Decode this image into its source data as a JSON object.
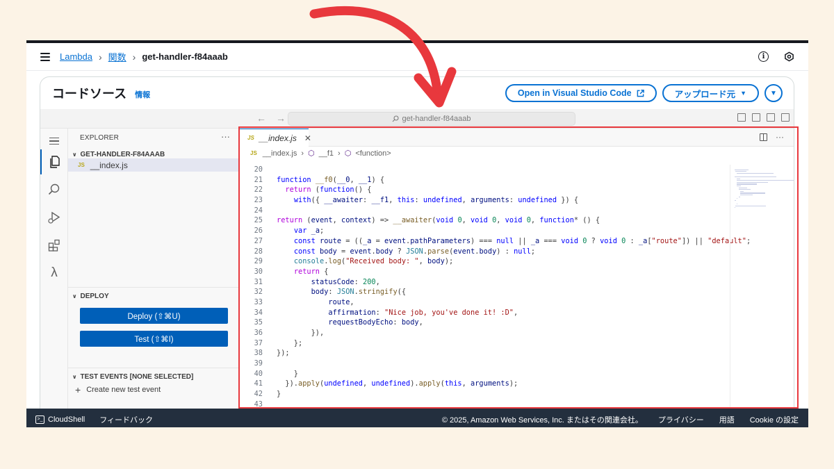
{
  "nav": {
    "breadcrumb": [
      "Lambda",
      "関数",
      "get-handler-f84aaab"
    ]
  },
  "panel": {
    "title": "コードソース",
    "info_link": "情報",
    "open_vscode_label": "Open in Visual Studio Code",
    "upload_label": "アップロード元"
  },
  "ide": {
    "command_center": "get-handler-f84aaab",
    "explorer": {
      "header": "EXPLORER",
      "folder": "GET-HANDLER-F84AAAB",
      "file": "__index.js",
      "file_badge": "JS"
    },
    "deploy": {
      "header": "DEPLOY",
      "deploy_label": "Deploy (⇧⌘U)",
      "test_label": "Test (⇧⌘I)"
    },
    "test_events": {
      "header": "TEST EVENTS [NONE SELECTED]",
      "create_label": "Create new test event"
    },
    "editor": {
      "tab_label": "__index.js",
      "breadcrumb": [
        "__index.js",
        "__f1",
        "<function>"
      ]
    }
  },
  "footer": {
    "cloudshell": "CloudShell",
    "feedback": "フィードバック",
    "copyright": "© 2025, Amazon Web Services, Inc. またはその関連会社。",
    "privacy": "プライバシー",
    "terms": "用語",
    "cookie": "Cookie の設定"
  },
  "code_lines": [
    {
      "n": "20",
      "text": ""
    },
    {
      "n": "21",
      "text": "function __f0(__0, __1) {"
    },
    {
      "n": "22",
      "text": "  return (function() {"
    },
    {
      "n": "23",
      "text": "    with({ __awaiter: __f1, this: undefined, arguments: undefined }) {"
    },
    {
      "n": "24",
      "text": ""
    },
    {
      "n": "25",
      "text": "return (event, context) => __awaiter(void 0, void 0, void 0, function* () {"
    },
    {
      "n": "26",
      "text": "    var _a;"
    },
    {
      "n": "27",
      "text": "    const route = ((_a = event.pathParameters) === null || _a === void 0 ? void 0 : _a[\"route\"]) || \"default\";"
    },
    {
      "n": "28",
      "text": "    const body = event.body ? JSON.parse(event.body) : null;"
    },
    {
      "n": "29",
      "text": "    console.log(\"Received body: \", body);"
    },
    {
      "n": "30",
      "text": "    return {"
    },
    {
      "n": "31",
      "text": "        statusCode: 200,"
    },
    {
      "n": "32",
      "text": "        body: JSON.stringify({"
    },
    {
      "n": "33",
      "text": "            route,"
    },
    {
      "n": "34",
      "text": "            affirmation: \"Nice job, you've done it! :D\","
    },
    {
      "n": "35",
      "text": "            requestBodyEcho: body,"
    },
    {
      "n": "36",
      "text": "        }),"
    },
    {
      "n": "37",
      "text": "    };"
    },
    {
      "n": "38",
      "text": "});"
    },
    {
      "n": "39",
      "text": ""
    },
    {
      "n": "40",
      "text": "    }"
    },
    {
      "n": "41",
      "text": "  }).apply(undefined, undefined).apply(this, arguments);"
    },
    {
      "n": "42",
      "text": "}"
    },
    {
      "n": "43",
      "text": ""
    }
  ],
  "colors": {
    "accent": "#0972d3",
    "highlight_box": "#e8383d",
    "arrow": "#e8383d",
    "footer_bg": "#232f3e"
  }
}
